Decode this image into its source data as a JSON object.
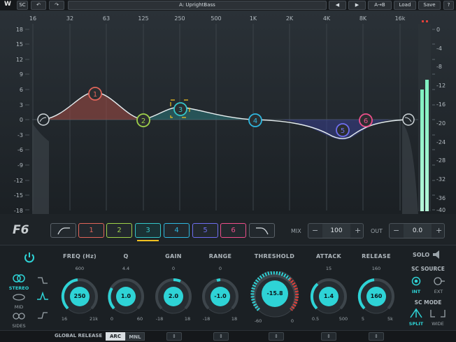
{
  "topbar": {
    "logo": "W",
    "sc_label": "SC",
    "preset_name": "A: UprightBass",
    "ab_label": "A→B",
    "load_label": "Load",
    "save_label": "Save",
    "help_label": "?"
  },
  "display": {
    "freq_labels": [
      "16",
      "32",
      "63",
      "125",
      "250",
      "500",
      "1K",
      "2K",
      "4K",
      "8K",
      "16k"
    ],
    "gain_labels": [
      "18",
      "15",
      "12",
      "9",
      "6",
      "3",
      "0",
      "-3",
      "-6",
      "-9",
      "-12",
      "-15",
      "-18"
    ],
    "meter_labels": [
      "0",
      "-4",
      "-8",
      "-12",
      "-16",
      "-20",
      "-24",
      "-28",
      "-32",
      "-36",
      "-40"
    ],
    "nodes": [
      "1",
      "2",
      "3",
      "4",
      "5",
      "6"
    ]
  },
  "bandstrip": {
    "logo": "F6",
    "bands": [
      "1",
      "2",
      "3",
      "4",
      "5",
      "6"
    ],
    "mix_label": "MIX",
    "mix_value": "100",
    "out_label": "OUT",
    "out_value": "0.0",
    "minus": "−",
    "plus": "+"
  },
  "panel": {
    "modes": {
      "stereo": "STEREO",
      "mid": "MID",
      "sides": "SIDES"
    },
    "knobs": [
      {
        "label": "FREQ (Hz)",
        "top": "600",
        "min": "16",
        "max": "21k",
        "value": "250"
      },
      {
        "label": "Q",
        "top": "4.4",
        "min": "0",
        "max": "60",
        "value": "1.0"
      },
      {
        "label": "GAIN",
        "top": "0",
        "min": "-18",
        "max": "18",
        "value": "2.0"
      },
      {
        "label": "RANGE",
        "top": "0",
        "min": "-18",
        "max": "18",
        "value": "-1.0"
      },
      {
        "label": "THRESHOLD",
        "top": "",
        "min": "-60",
        "max": "0",
        "value": "-15.8"
      },
      {
        "label": "ATTACK",
        "top": "15",
        "min": "0.5",
        "max": "500",
        "value": "1.4"
      },
      {
        "label": "RELEASE",
        "top": "160",
        "min": "5",
        "max": "5k",
        "value": "160"
      }
    ],
    "solo_label": "SOLO",
    "sc_source_label": "SC SOURCE",
    "int_label": "INT",
    "ext_label": "EXT",
    "sc_mode_label": "SC MODE",
    "split_label": "SPLIT",
    "wide_label": "WIDE"
  },
  "bottom": {
    "global_release_label": "GLOBAL RELEASE",
    "arc_label": "ARC",
    "mnl_label": "MNL"
  },
  "colors": {
    "band1": "#e0655a",
    "band2": "#9fd14a",
    "band3": "#34c6c9",
    "band4": "#2fb7e0",
    "band5": "#6e6ef0",
    "band6": "#ee4f8b",
    "accent": "#2ed3d6"
  }
}
